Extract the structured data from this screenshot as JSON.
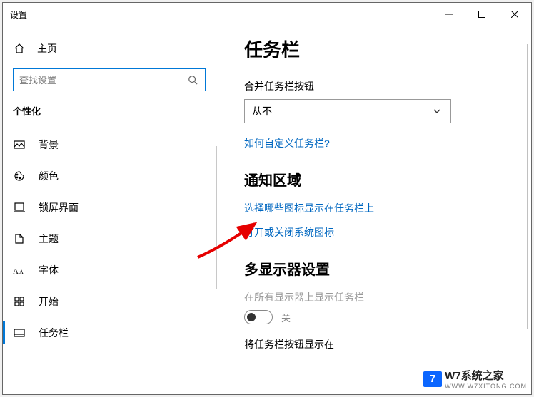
{
  "window": {
    "title": "设置"
  },
  "home_label": "主页",
  "search": {
    "placeholder": "查找设置"
  },
  "sidebar_section": "个性化",
  "nav": {
    "background": "背景",
    "color": "颜色",
    "lockscreen": "锁屏界面",
    "theme": "主题",
    "font": "字体",
    "start": "开始",
    "taskbar": "任务栏"
  },
  "content": {
    "page_title": "任务栏",
    "combine_label": "合并任务栏按钮",
    "combine_value": "从不",
    "help_link": "如何自定义任务栏?",
    "notif_heading": "通知区域",
    "notif_link1": "选择哪些图标显示在任务栏上",
    "notif_link2": "打开或关闭系统图标",
    "multi_heading": "多显示器设置",
    "multi_toggle_label": "在所有显示器上显示任务栏",
    "toggle_state": "关",
    "multi_combo_label": "将任务栏按钮显示在"
  },
  "watermark": {
    "brand": "W7系统之家",
    "url": "WWW.W7XITONG.COM",
    "logo": "7"
  }
}
